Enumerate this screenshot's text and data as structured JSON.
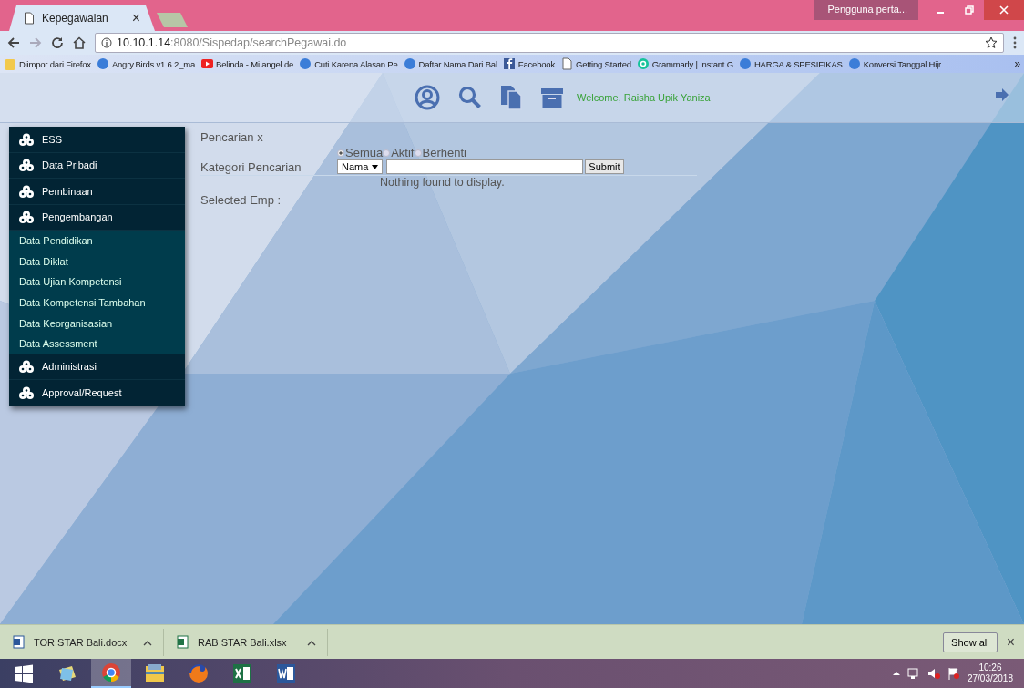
{
  "browser": {
    "tab": {
      "title": "Kepegawaian",
      "close": "×"
    },
    "profile": "Pengguna perta...",
    "url": {
      "host": "10.10.1.14",
      "rest": ":8080/Sispedap/searchPegawai.do"
    },
    "bookmarks": [
      {
        "label": "Diimpor dari Firefox",
        "kind": "folder"
      },
      {
        "label": "Angry.Birds.v1.6.2_ma",
        "kind": "site"
      },
      {
        "label": "Belinda - Mi angel de",
        "kind": "video"
      },
      {
        "label": "Cuti Karena Alasan Pe",
        "kind": "site"
      },
      {
        "label": "Daftar Nama Dari Bal",
        "kind": "site"
      },
      {
        "label": "Facebook",
        "kind": "facebook"
      },
      {
        "label": "Getting Started",
        "kind": "page"
      },
      {
        "label": "Grammarly | Instant G",
        "kind": "grammarly"
      },
      {
        "label": "HARGA & SPESIFIKAS",
        "kind": "site"
      },
      {
        "label": "Konversi Tanggal Hijr",
        "kind": "site"
      }
    ],
    "more": "»"
  },
  "header": {
    "welcome": "Welcome, Raisha Upik Yaniza"
  },
  "sidebar": {
    "items": [
      {
        "label": "ESS"
      },
      {
        "label": "Data Pribadi"
      },
      {
        "label": "Pembinaan"
      },
      {
        "label": "Pengembangan",
        "children": [
          {
            "label": "Data Pendidikan"
          },
          {
            "label": "Data Diklat"
          },
          {
            "label": "Data Ujian Kompetensi"
          },
          {
            "label": "Data Kompetensi Tambahan"
          },
          {
            "label": "Data Keorganisasian"
          },
          {
            "label": "Data Assessment"
          }
        ]
      },
      {
        "label": "Administrasi"
      },
      {
        "label": "Approval/Request"
      }
    ]
  },
  "search": {
    "title": "Pencarian x",
    "filters": [
      {
        "label": "Semua",
        "selected": true
      },
      {
        "label": "Aktif",
        "selected": false
      },
      {
        "label": "Berhenti",
        "selected": false
      }
    ],
    "category_label": "Kategori Pencarian",
    "category": "Nama",
    "submit": "Submit",
    "empty_message": "Nothing found to display.",
    "selected_label": "Selected Emp :"
  },
  "downloads": {
    "files": [
      {
        "name": "TOR STAR Bali.docx",
        "kind": "word"
      },
      {
        "name": "RAB STAR Bali.xlsx",
        "kind": "excel"
      }
    ],
    "show_all": "Show all",
    "close": "×"
  },
  "taskbar": {
    "apps": [
      {
        "kind": "start",
        "selected": false
      },
      {
        "kind": "notes",
        "selected": false
      },
      {
        "kind": "chrome",
        "selected": true
      },
      {
        "kind": "explorer",
        "selected": false
      },
      {
        "kind": "firefox",
        "selected": false
      },
      {
        "kind": "excel",
        "selected": false
      },
      {
        "kind": "word",
        "selected": false
      }
    ],
    "time": "10:26",
    "date": "27/03/2018"
  }
}
